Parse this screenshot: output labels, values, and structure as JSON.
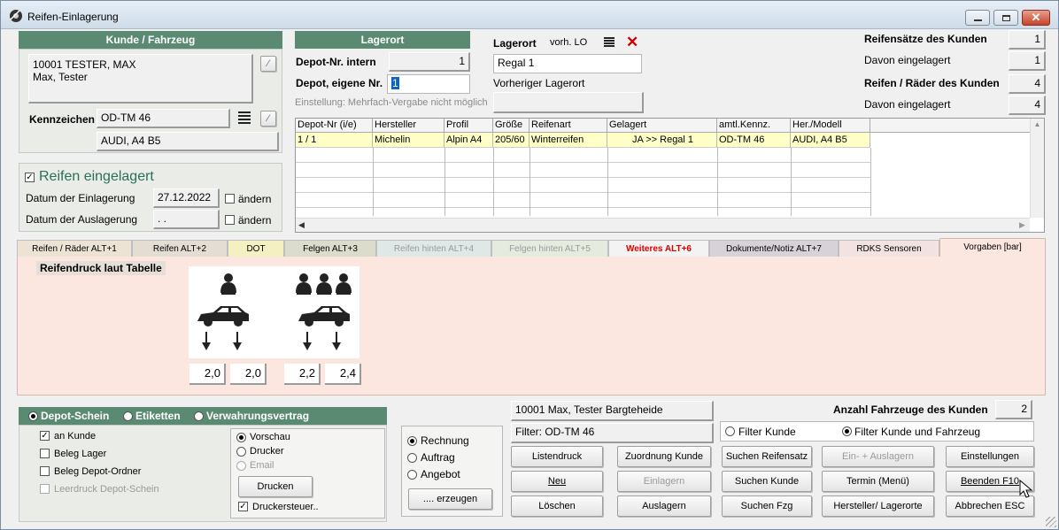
{
  "window": {
    "title": "Reifen-Einlagerung"
  },
  "kunde": {
    "header": "Kunde / Fahrzeug",
    "address_line1": "10001 TESTER, MAX",
    "address_line2": "Max, Tester",
    "kennzeichen_label": "Kennzeichen",
    "kennzeichen_value": "OD-TM 46",
    "fahrzeug_value": "AUDI, A4 B5"
  },
  "einlagerung": {
    "checkbox_label": "Reifen eingelagert",
    "checked": true,
    "datum_ein_label": "Datum der Einlagerung",
    "datum_ein_value": "27.12.2022",
    "datum_aus_label": "Datum der Auslagerung",
    "datum_aus_value": ". .",
    "aendern_label": "ändern"
  },
  "lagerort": {
    "header": "Lagerort",
    "depot_intern_label": "Depot-Nr. intern",
    "depot_intern_value": "1",
    "depot_eigene_label": "Depot, eigene Nr.",
    "depot_eigene_value": "1",
    "einstellung_note": "Einstellung: Mehrfach-Vergabe nicht möglich",
    "lagerort_label": "Lagerort",
    "vorh_lo_label": "vorh. LO",
    "lagerort_value": "Regal 1",
    "vorheriger_label": "Vorheriger Lagerort",
    "vorheriger_value": ""
  },
  "summary": {
    "reifensaetze_label": "Reifensätze des Kunden",
    "reifensaetze_value": "1",
    "davon1_label": "Davon eingelagert",
    "davon1_value": "1",
    "reifen_raeder_label": "Reifen / Räder des Kunden",
    "reifen_raeder_value": "4",
    "davon2_label": "Davon eingelagert",
    "davon2_value": "4"
  },
  "table": {
    "columns": [
      "Depot-Nr (i/e)",
      "Hersteller",
      "Profil",
      "Größe",
      "Reifenart",
      "Gelagert",
      "amtl.Kennz.",
      "Her./Modell"
    ],
    "rows": [
      [
        "1 / 1",
        "Michelin",
        "Alpin A4",
        "205/60",
        "Winterreifen",
        "JA >> Regal 1",
        "OD-TM 46",
        "AUDI, A4 B5"
      ]
    ]
  },
  "tabs": [
    {
      "label": "Reifen / Räder ALT+1",
      "color": "#ece3d4"
    },
    {
      "label": "Reifen ALT+2",
      "color": "#e3ddd3"
    },
    {
      "label": "DOT",
      "color": "#f4f0c2"
    },
    {
      "label": "Felgen ALT+3",
      "color": "#dcdccc"
    },
    {
      "label": "Reifen hinten ALT+4",
      "color": "#dfe8e6"
    },
    {
      "label": "Felgen hinten ALT+5",
      "color": "#e5ecdf"
    },
    {
      "label": "Weiteres ALT+6",
      "color": "#f3f3f3"
    },
    {
      "label": "Dokumente/Notiz ALT+7",
      "color": "#d7d2d8"
    },
    {
      "label": "RDKS Sensoren",
      "color": "#f2e2e2"
    },
    {
      "label": "Vorgaben [bar]",
      "color": "#fbe7e0"
    }
  ],
  "vorgaben": {
    "title": "Reifendruck laut Tabelle",
    "pressures": [
      "2,0",
      "2,0",
      "2,2",
      "2,4"
    ]
  },
  "print": {
    "mode_options": [
      "Depot-Schein",
      "Etiketten",
      "Verwahrungsvertrag"
    ],
    "an_kunde": "an Kunde",
    "beleg_lager": "Beleg Lager",
    "beleg_depot": "Beleg Depot-Ordner",
    "leerdruck": "Leerdruck Depot-Schein",
    "vorschau": "Vorschau",
    "drucker": "Drucker",
    "email": "Email",
    "drucken_button": "Drucken",
    "druckersteuer": "Druckersteuer..",
    "rechnung": "Rechnung",
    "auftrag": "Auftrag",
    "angebot": "Angebot",
    "erzeugen_button": ".... erzeugen"
  },
  "kunde_info": {
    "name_field": "10001 Max, Tester Bargteheide",
    "filter_field": "Filter: OD-TM 46",
    "anzahl_label": "Anzahl Fahrzeuge des Kunden",
    "anzahl_value": "2",
    "filter_kunde": "Filter Kunde",
    "filter_kunde_fahrzeug": "Filter Kunde und Fahrzeug"
  },
  "buttons": {
    "listendruck": "Listendruck",
    "zuordnung_kunde": "Zuordnung Kunde",
    "suchen_reifensatz": "Suchen Reifensatz",
    "ein_auslagern": "Ein- + Auslagern",
    "einstellungen": "Einstellungen",
    "neu": "Neu",
    "einlagern": "Einlagern",
    "suchen_kunde": "Suchen Kunde",
    "termin": "Termin (Menü)",
    "beenden": "Beenden F10",
    "loeschen": "Löschen",
    "auslagern": "Auslagern",
    "suchen_fzg": "Suchen Fzg",
    "hersteller_lagerorte": "Hersteller/ Lagerorte",
    "abbrechen": "Abbrechen ESC"
  }
}
